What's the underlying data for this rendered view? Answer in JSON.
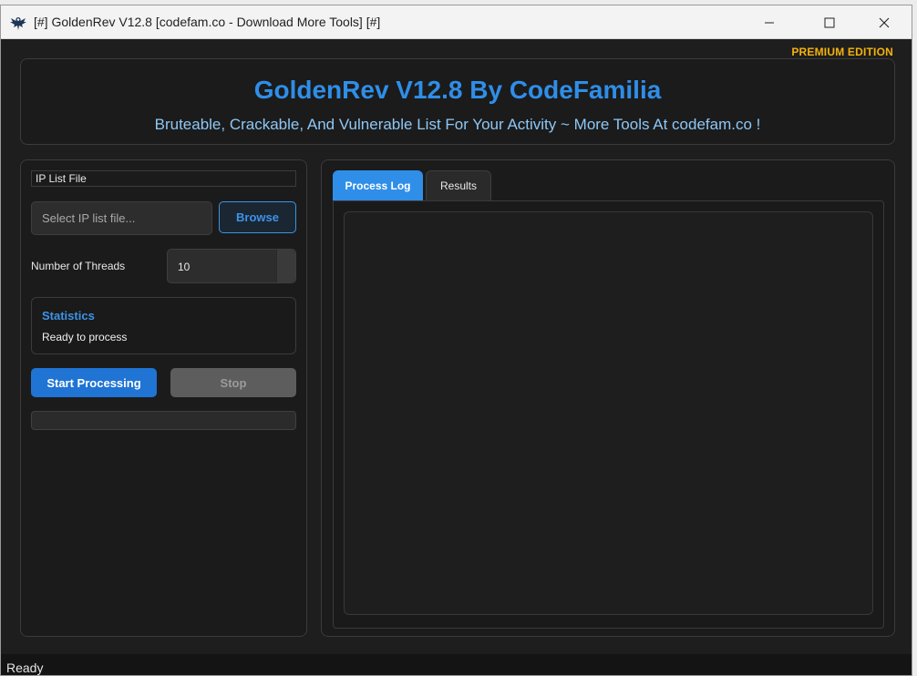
{
  "window": {
    "title": "[#] GoldenRev V12.8 [codefam.co - Download More Tools] [#]",
    "app_icon": "eagle-icon",
    "controls": [
      "minimize-icon",
      "maximize-icon",
      "close-icon"
    ]
  },
  "edition_badge": "PREMIUM EDITION",
  "header": {
    "title": "GoldenRev V12.8 By CodeFamilia",
    "subtitle": "Bruteable, Crackable, And Vulnerable List For Your Activity ~ More Tools At codefam.co !"
  },
  "left_panel": {
    "ip_list_label": "IP List File",
    "ip_input_placeholder": "Select IP list file...",
    "browse_label": "Browse",
    "threads_label": "Number of Threads",
    "threads_value": "10",
    "statistics": {
      "title": "Statistics",
      "status": "Ready to process"
    },
    "start_label": "Start Processing",
    "stop_label": "Stop",
    "progress": 0
  },
  "right_panel": {
    "tabs": [
      {
        "label": "Process Log",
        "active": true
      },
      {
        "label": "Results",
        "active": false
      }
    ],
    "log_text": ""
  },
  "statusbar": {
    "text": "Ready"
  },
  "colors": {
    "accent": "#2f8ee8",
    "premium": "#f5b20a",
    "background": "#1e1e1e"
  }
}
